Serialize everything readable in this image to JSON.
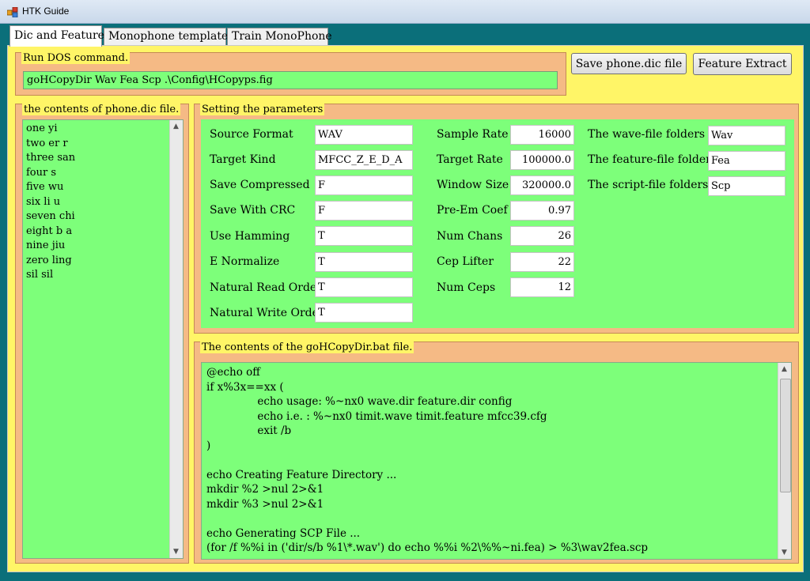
{
  "window": {
    "title": "HTK Guide"
  },
  "tabs": [
    {
      "label": "Dic and Feature"
    },
    {
      "label": "Monophone template"
    },
    {
      "label": "Train MonoPhone"
    }
  ],
  "dos": {
    "group_title": "Run DOS command.",
    "command": "goHCopyDir Wav Fea Scp .\\Config\\HCopyps.fig"
  },
  "buttons": {
    "save_phone": "Save phone.dic file",
    "feature_extract": "Feature Extract"
  },
  "phonedic": {
    "group_title": "the contents of phone.dic file.",
    "lines": [
      "one yi",
      "two er r",
      "three san",
      "four s",
      "five wu",
      "six li u",
      "seven chi",
      "eight b a",
      "nine jiu",
      "zero ling",
      "sil sil"
    ]
  },
  "params": {
    "group_title": "Setting the parameters",
    "col1": [
      {
        "label": "Source Format",
        "value": "WAV"
      },
      {
        "label": "Target Kind",
        "value": "MFCC_Z_E_D_A"
      },
      {
        "label": "Save Compressed",
        "value": "F"
      },
      {
        "label": "Save With CRC",
        "value": "F"
      },
      {
        "label": "Use Hamming",
        "value": "T"
      },
      {
        "label": "E Normalize",
        "value": "T"
      },
      {
        "label": "Natural  Read Order",
        "value": "T"
      },
      {
        "label": "Natural Write Order",
        "value": "T"
      }
    ],
    "col2": [
      {
        "label": "Sample Rate",
        "value": "16000"
      },
      {
        "label": "Target Rate",
        "value": "100000.0"
      },
      {
        "label": "Window Size",
        "value": "320000.0"
      },
      {
        "label": "Pre-Em Coef",
        "value": "0.97"
      },
      {
        "label": "Num Chans",
        "value": "26"
      },
      {
        "label": "Cep Lifter",
        "value": "22"
      },
      {
        "label": "Num Ceps",
        "value": "12"
      }
    ],
    "col3": [
      {
        "label": "The wave-file folders",
        "value": "Wav"
      },
      {
        "label": "The feature-file folders",
        "value": "Fea"
      },
      {
        "label": "The script-file folders",
        "value": "Scp"
      }
    ]
  },
  "bat": {
    "group_title": "The contents of the goHCopyDir.bat file.",
    "lines": [
      "@echo off",
      "if x%3x==xx (",
      "               echo usage: %~nx0 wave.dir feature.dir config",
      "               echo i.e. : %~nx0 timit.wave timit.feature mfcc39.cfg",
      "               exit /b",
      ")",
      "",
      "echo Creating Feature Directory ...",
      "mkdir %2 >nul 2>&1",
      "mkdir %3 >nul 2>&1",
      "",
      "echo Generating SCP File ...",
      "(for /f %%i in ('dir/s/b %1\\*.wav') do echo %%i %2\\%%~ni.fea) > %3\\wav2fea.scp"
    ]
  },
  "colors": {
    "panel": "#fff567",
    "group": "#f5ba85",
    "green": "#7dff7a",
    "frame": "#0b6f7a"
  }
}
